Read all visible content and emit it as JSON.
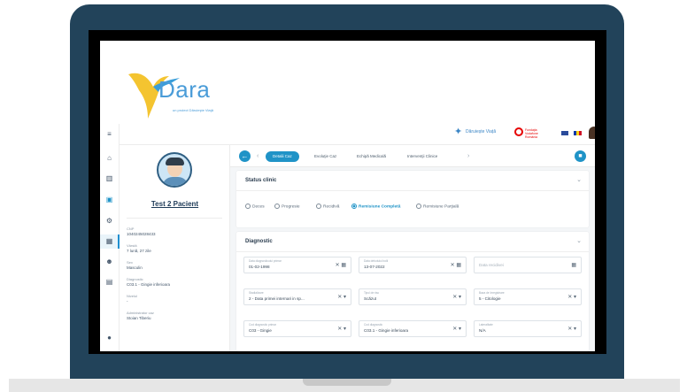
{
  "brand": {
    "name": "Dara",
    "tagline": "un proiect Dăruieşte Viaţă"
  },
  "topbar": {
    "partner_name": "Dăruiește Viață",
    "partner2_name": "Fundaţia Vodafone România",
    "flags": [
      "uk-flag",
      "ro-flag"
    ]
  },
  "sidebar": {
    "items": [
      {
        "icon": "menu-icon",
        "glyph": "≡"
      },
      {
        "icon": "home-icon",
        "glyph": "⌂"
      },
      {
        "icon": "chart-icon",
        "glyph": "▥"
      },
      {
        "icon": "patient-file-icon",
        "glyph": "▣",
        "active": true
      },
      {
        "icon": "settings-icon",
        "glyph": "⚙"
      },
      {
        "icon": "calendar-icon",
        "glyph": "▦"
      },
      {
        "icon": "users-icon",
        "glyph": "☻"
      },
      {
        "icon": "document-icon",
        "glyph": "▤"
      },
      {
        "icon": "info-icon",
        "glyph": "●"
      }
    ]
  },
  "patient": {
    "name": "Test 2 Pacient",
    "fields": [
      {
        "label": "CNP",
        "value": "1040245028433"
      },
      {
        "label": "Vârstă",
        "value": "7 lună, 27 zile"
      },
      {
        "label": "Sex",
        "value": "Masculin"
      },
      {
        "label": "Diagnostic",
        "value": "C03.1 - Gingie inferioara"
      },
      {
        "label": "Nivelul",
        "value": "-"
      },
      {
        "label": "Administrator caz",
        "value": "Stoian Tiberiu"
      }
    ]
  },
  "tabs": {
    "items": [
      "Detalii Caz",
      "Evoluţie Caz",
      "Echipă Medicală",
      "Intervenţii Clinice"
    ],
    "active": "Detalii Caz"
  },
  "status_clinic": {
    "title": "Status clinic",
    "options": [
      "Deces",
      "Progresie",
      "Recidivă",
      "Remisiune Completă",
      "Remisiune Parţială"
    ],
    "selected": "Remisiune Completă"
  },
  "diagnostic": {
    "title": "Diagnostic",
    "fields": [
      {
        "label": "Data diagnosticului primar",
        "value": "01-02-1998",
        "icons": "✕ ▦"
      },
      {
        "label": "Data debutului bolii",
        "value": "13-07-2022",
        "icons": "✕ ▦"
      },
      {
        "label": "",
        "value": "",
        "placeholder": "Data recidivei",
        "icons": "▦"
      },
      {
        "label": "Stadializare",
        "value": "2 - Data primei internari in sp...",
        "icons": "✕ ▾"
      },
      {
        "label": "Tipul de risc",
        "value": "Scăzut",
        "icons": "✕ ▾"
      },
      {
        "label": "Baza de înregistrare",
        "value": "5 - Citologie",
        "icons": "✕ ▾"
      },
      {
        "label": "Cod diagnostic primar",
        "value": "C03 - Gingie",
        "icons": "✕ ▾"
      },
      {
        "label": "Cod diagnostic",
        "value": "C03.1 - Gingie inferioara",
        "icons": "✕ ▾"
      },
      {
        "label": "Lateralitate",
        "value": "N/A",
        "icons": "✕ ▾"
      }
    ]
  },
  "colors": {
    "accent": "#1f93c7",
    "frame": "#22435a",
    "brand": "#4a9cd8"
  }
}
